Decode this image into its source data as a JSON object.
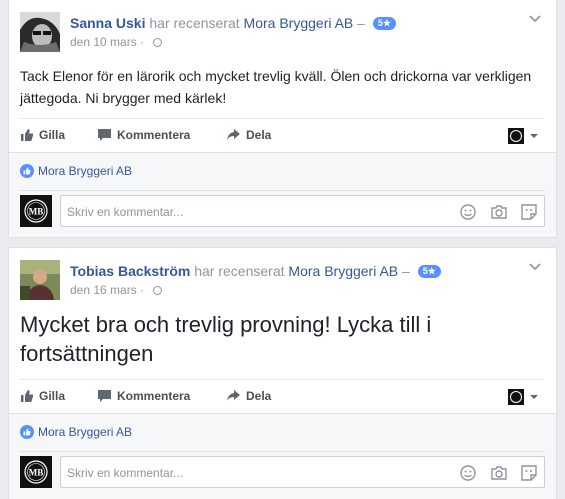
{
  "reviews": [
    {
      "author": "Sanna Uski",
      "verb": "har recenserat",
      "page": "Mora Bryggeri AB",
      "dash": "–",
      "rating": "5★",
      "date": "den 10 mars",
      "separator": "·",
      "text_lines": [
        "Tack Elenor för en lärorik och mycket trevlig kväll. Ölen och drickorna var verkligen",
        "jättegoda. Ni brygger med kärlek!"
      ]
    },
    {
      "author": "Tobias Backström",
      "verb": "har recenserat",
      "page": "Mora Bryggeri AB",
      "dash": "–",
      "rating": "5★",
      "date": "den 16 mars",
      "separator": "·",
      "text_lines": [
        "Mycket bra och trevlig provning! Lycka till i",
        "fortsättningen"
      ]
    }
  ],
  "actions": {
    "like": "Gilla",
    "comment": "Kommentera",
    "share": "Dela"
  },
  "likes_by": "Mora Bryggeri AB",
  "comment_placeholder": "Skriv en kommentar...",
  "page_logo_text": "MB",
  "icons": [
    "chevron-down-icon",
    "globe-icon",
    "like-icon",
    "comment-icon",
    "share-icon",
    "emoji-icon",
    "camera-icon",
    "sticker-icon"
  ],
  "colors": {
    "link": "#365899",
    "accent": "#5890ff",
    "muted": "#90949c",
    "background": "#e9ebee"
  }
}
